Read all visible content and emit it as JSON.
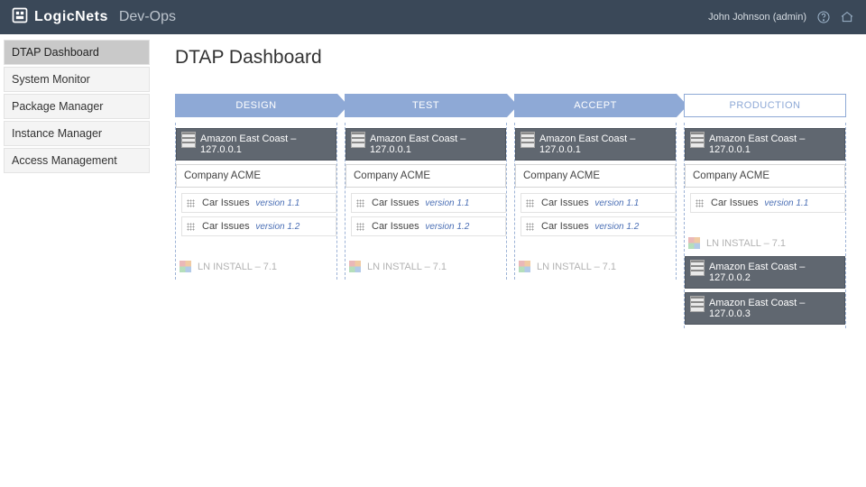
{
  "header": {
    "brand": "LogicNets",
    "subbrand": "Dev-Ops",
    "user": "John Johnson (admin)"
  },
  "sidebar": {
    "items": [
      {
        "label": "DTAP Dashboard",
        "active": true
      },
      {
        "label": "System Monitor"
      },
      {
        "label": "Package Manager"
      },
      {
        "label": "Instance Manager"
      },
      {
        "label": "Access Management"
      }
    ]
  },
  "page": {
    "title": "DTAP Dashboard"
  },
  "stages": [
    {
      "name": "DESIGN",
      "style": "blue",
      "instances": [
        {
          "label": "Amazon East Coast – 127.0.0.1",
          "companies": [
            {
              "label": "Company ACME",
              "packages": [
                {
                  "name": "Car Issues",
                  "version": "version 1.1"
                },
                {
                  "name": "Car Issues",
                  "version": "version 1.2"
                }
              ]
            }
          ],
          "install": "LN INSTALL – 7.1"
        }
      ]
    },
    {
      "name": "TEST",
      "style": "blue",
      "instances": [
        {
          "label": "Amazon East Coast – 127.0.0.1",
          "companies": [
            {
              "label": "Company ACME",
              "packages": [
                {
                  "name": "Car Issues",
                  "version": "version 1.1"
                },
                {
                  "name": "Car Issues",
                  "version": "version 1.2"
                }
              ]
            }
          ],
          "install": "LN INSTALL – 7.1"
        }
      ]
    },
    {
      "name": "ACCEPT",
      "style": "blue",
      "instances": [
        {
          "label": "Amazon East Coast – 127.0.0.1",
          "companies": [
            {
              "label": "Company ACME",
              "packages": [
                {
                  "name": "Car Issues",
                  "version": "version 1.1"
                },
                {
                  "name": "Car Issues",
                  "version": "version 1.2"
                }
              ]
            }
          ],
          "install": "LN INSTALL – 7.1"
        }
      ]
    },
    {
      "name": "PRODUCTION",
      "style": "outline",
      "instances": [
        {
          "label": "Amazon East Coast – 127.0.0.1",
          "companies": [
            {
              "label": "Company ACME",
              "packages": [
                {
                  "name": "Car Issues",
                  "version": "version 1.1"
                }
              ]
            }
          ],
          "install": "LN INSTALL – 7.1"
        },
        {
          "label": "Amazon East Coast – 127.0.0.2"
        },
        {
          "label": "Amazon East Coast – 127.0.0.3"
        }
      ]
    }
  ]
}
